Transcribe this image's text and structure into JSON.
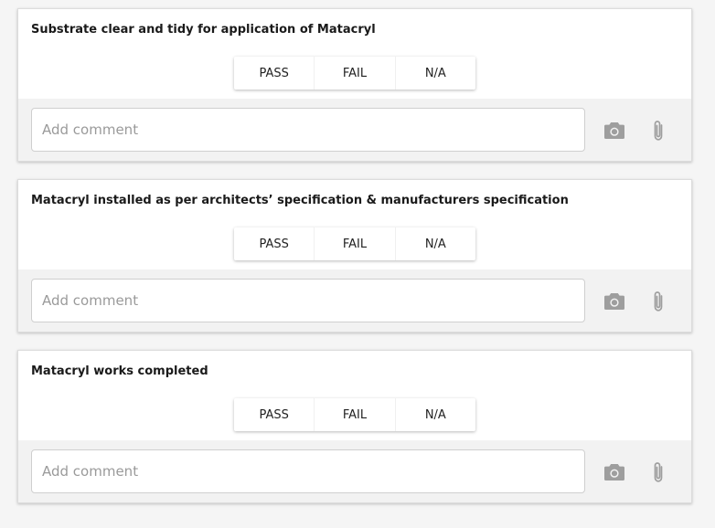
{
  "checklist": [
    {
      "question": "Substrate clear and tidy for application of Matacryl",
      "options": [
        "PASS",
        "FAIL",
        "N/A"
      ],
      "comment_placeholder": "Add comment"
    },
    {
      "question": "Matacryl installed as per architects’ specification & manufacturers specification",
      "options": [
        "PASS",
        "FAIL",
        "N/A"
      ],
      "comment_placeholder": "Add comment"
    },
    {
      "question": "Matacryl works completed",
      "options": [
        "PASS",
        "FAIL",
        "N/A"
      ],
      "comment_placeholder": "Add comment"
    }
  ],
  "icons": {
    "camera": "camera-icon",
    "attach": "paperclip-icon"
  },
  "colors": {
    "page_background": "#f5f5f5",
    "card_background": "#ffffff",
    "comment_area_background": "#f2f2f2",
    "icon": "#9e9e9e"
  }
}
